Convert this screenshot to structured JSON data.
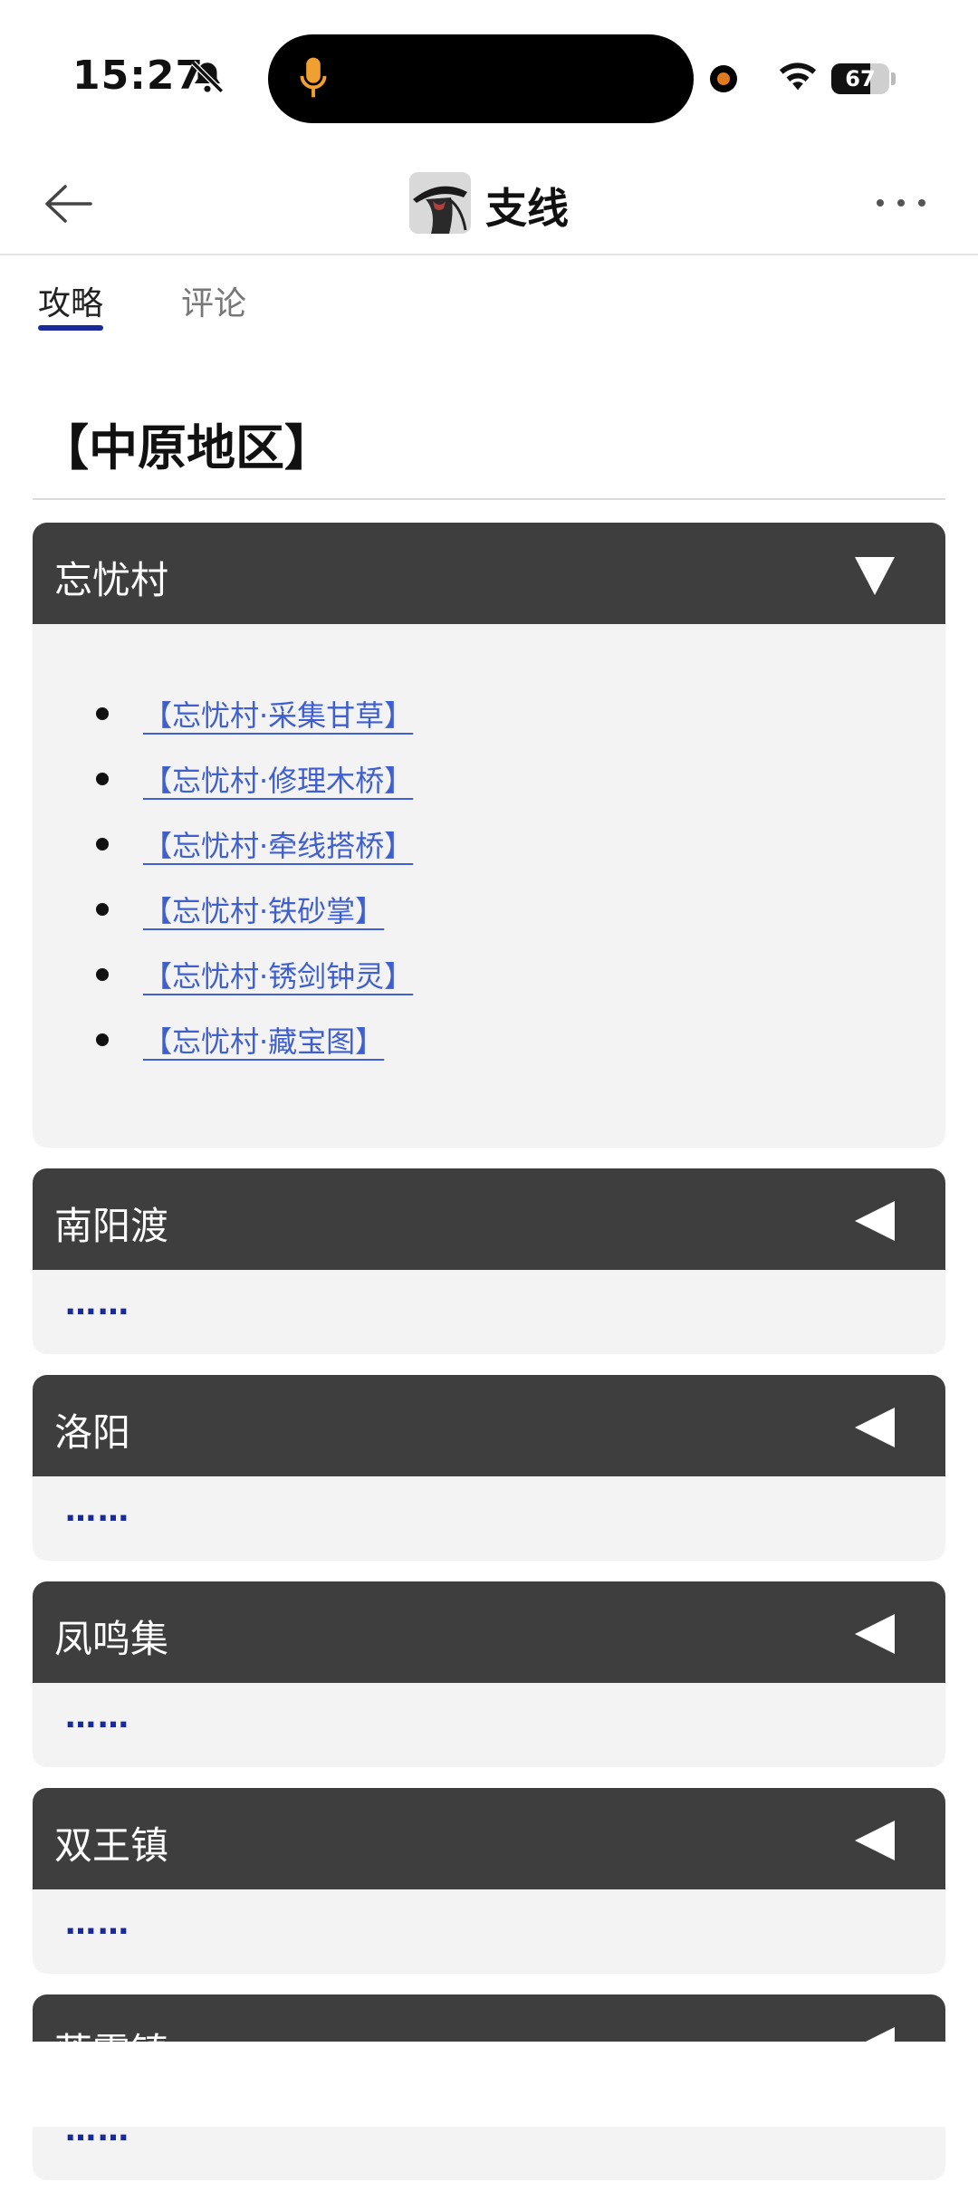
{
  "status_bar": {
    "time": "15:27",
    "battery_percent": "67",
    "battery_level": 0.67,
    "icons": [
      "bell-slash-icon",
      "microphone-icon",
      "recording-dot-icon",
      "wifi-icon",
      "battery-icon"
    ]
  },
  "nav": {
    "title": "支线",
    "back_icon": "arrow-left-icon",
    "more_icon": "more-horizontal-icon"
  },
  "tabs": [
    {
      "label": "攻略",
      "active": true
    },
    {
      "label": "评论",
      "active": false
    }
  ],
  "region_title": "【中原地区】",
  "sections": [
    {
      "title": "忘忧村",
      "expanded": true,
      "links": [
        "【忘忧村·采集甘草】",
        "【忘忧村·修理木桥】",
        "【忘忧村·牵线搭桥】",
        "【忘忧村·铁砂掌】",
        "【忘忧村·锈剑钟灵】",
        "【忘忧村·藏宝图】"
      ]
    },
    {
      "title": "南阳渡",
      "expanded": false,
      "placeholder": "……"
    },
    {
      "title": "洛阳",
      "expanded": false,
      "placeholder": "……"
    },
    {
      "title": "凤鸣集",
      "expanded": false,
      "placeholder": "……"
    },
    {
      "title": "双王镇",
      "expanded": false,
      "placeholder": "……"
    },
    {
      "title": "落霞镇",
      "expanded": false,
      "placeholder": "……"
    }
  ],
  "colors": {
    "header_bg": "#3e3e3e",
    "body_bg": "#f3f3f3",
    "link": "#3f5fcf",
    "accent": "#1a2a9a"
  }
}
